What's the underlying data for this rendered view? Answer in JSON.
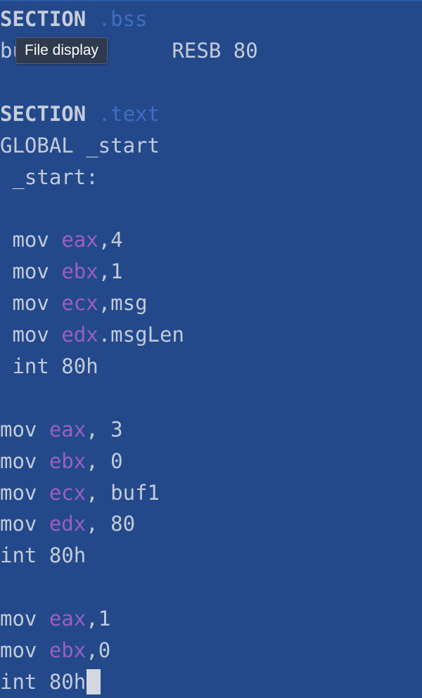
{
  "tooltip": {
    "text": "File display"
  },
  "editor": {
    "lines": [
      {
        "tokens": [
          {
            "t": "SECTION ",
            "k": "dir"
          },
          {
            "t": ".bss",
            "k": "sec"
          }
        ]
      },
      {
        "tokens": [
          {
            "t": "bu",
            "k": "plain"
          },
          {
            "t": "            ",
            "k": "plain"
          },
          {
            "t": "RESB 80",
            "k": "plain"
          }
        ]
      },
      {
        "tokens": []
      },
      {
        "tokens": [
          {
            "t": "SECTION ",
            "k": "dir"
          },
          {
            "t": ".text",
            "k": "sec"
          }
        ]
      },
      {
        "tokens": [
          {
            "t": "GLOBAL _start",
            "k": "plain"
          }
        ]
      },
      {
        "tokens": [
          {
            "t": " _start:",
            "k": "plain"
          }
        ]
      },
      {
        "tokens": []
      },
      {
        "tokens": [
          {
            "t": " mov ",
            "k": "plain"
          },
          {
            "t": "eax",
            "k": "reg"
          },
          {
            "t": ",4",
            "k": "plain"
          }
        ]
      },
      {
        "tokens": [
          {
            "t": " mov ",
            "k": "plain"
          },
          {
            "t": "ebx",
            "k": "reg"
          },
          {
            "t": ",1",
            "k": "plain"
          }
        ]
      },
      {
        "tokens": [
          {
            "t": " mov ",
            "k": "plain"
          },
          {
            "t": "ecx",
            "k": "reg"
          },
          {
            "t": ",msg",
            "k": "plain"
          }
        ]
      },
      {
        "tokens": [
          {
            "t": " mov ",
            "k": "plain"
          },
          {
            "t": "edx",
            "k": "reg"
          },
          {
            "t": ".msgLen",
            "k": "plain"
          }
        ]
      },
      {
        "tokens": [
          {
            "t": " int 80h",
            "k": "plain"
          }
        ]
      },
      {
        "tokens": []
      },
      {
        "tokens": [
          {
            "t": "mov ",
            "k": "plain"
          },
          {
            "t": "eax",
            "k": "reg"
          },
          {
            "t": ", 3",
            "k": "plain"
          }
        ]
      },
      {
        "tokens": [
          {
            "t": "mov ",
            "k": "plain"
          },
          {
            "t": "ebx",
            "k": "reg"
          },
          {
            "t": ", 0",
            "k": "plain"
          }
        ]
      },
      {
        "tokens": [
          {
            "t": "mov ",
            "k": "plain"
          },
          {
            "t": "ecx",
            "k": "reg"
          },
          {
            "t": ", buf1",
            "k": "plain"
          }
        ]
      },
      {
        "tokens": [
          {
            "t": "mov ",
            "k": "plain"
          },
          {
            "t": "edx",
            "k": "reg"
          },
          {
            "t": ", 80",
            "k": "plain"
          }
        ]
      },
      {
        "tokens": [
          {
            "t": "int 80h",
            "k": "plain"
          }
        ]
      },
      {
        "tokens": []
      },
      {
        "tokens": [
          {
            "t": "mov ",
            "k": "plain"
          },
          {
            "t": "eax",
            "k": "reg"
          },
          {
            "t": ",1",
            "k": "plain"
          }
        ]
      },
      {
        "tokens": [
          {
            "t": "mov ",
            "k": "plain"
          },
          {
            "t": "ebx",
            "k": "reg"
          },
          {
            "t": ",0",
            "k": "plain"
          }
        ]
      },
      {
        "tokens": [
          {
            "t": "int 80h",
            "k": "plain"
          }
        ],
        "cursor": true
      }
    ]
  },
  "colors": {
    "background": "#23498b",
    "text": "#c3cbd9",
    "section_name": "#3f6fc4",
    "register": "#9a5fc0",
    "tooltip_bg": "#2f3a4f"
  }
}
